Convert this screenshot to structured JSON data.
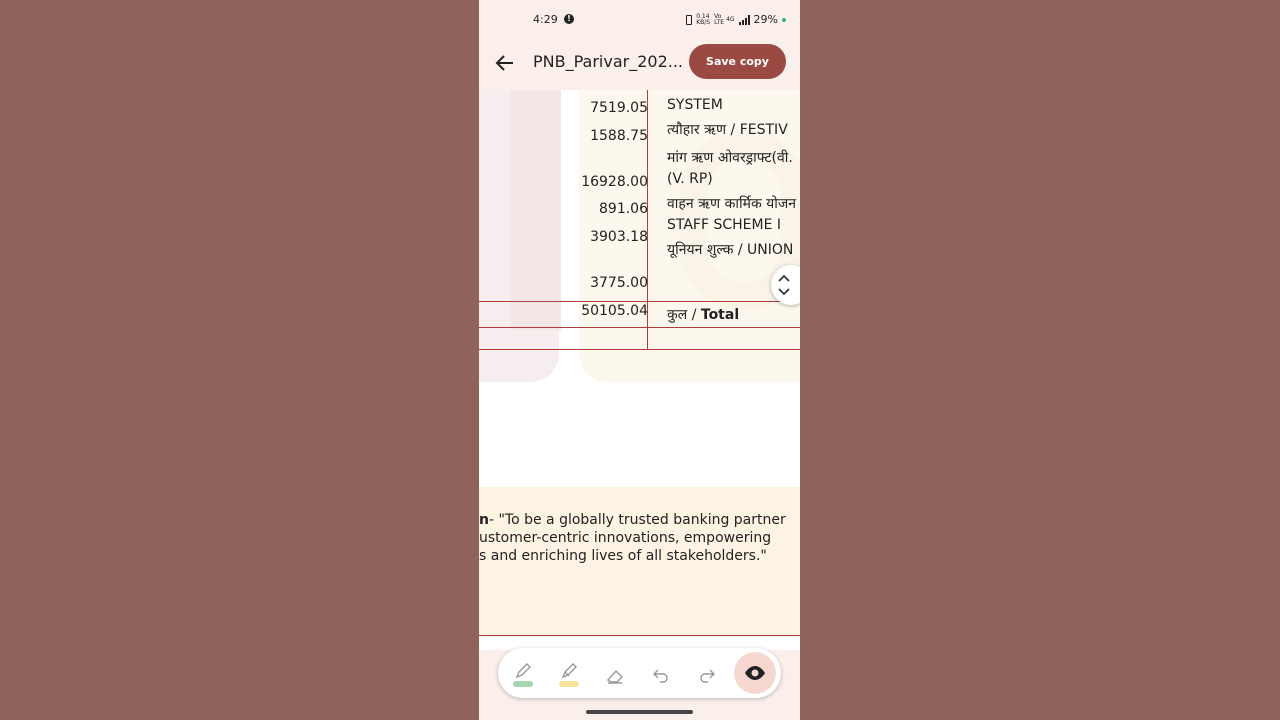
{
  "status_bar": {
    "time": "4:29",
    "alert_glyph": "!",
    "net_speed": "0.14",
    "net_unit": "KB/S",
    "vo_lte": "Vo LTE",
    "signal": "4G",
    "battery": "29%"
  },
  "app_bar": {
    "back_icon": "arrow-left-icon",
    "file_title": "PNB_Parivar_202...",
    "save_label": "Save copy"
  },
  "table": {
    "rows": [
      {
        "amount": "7519.05",
        "desc": "SYSTEM"
      },
      {
        "amount": "1588.75",
        "desc": "त्यौहार ऋण / FESTIV"
      },
      {
        "amount": "",
        "desc": "मांग ऋण ओवरड्राफ्ट(वी."
      },
      {
        "amount": "16928.00",
        "desc": "(V. RP)"
      },
      {
        "amount": "891.06",
        "desc": "वाहन ऋण कार्मिक योजन"
      },
      {
        "amount": "3903.18",
        "desc": "STAFF SCHEME I"
      },
      {
        "amount": "",
        "desc": "यूनियन शुल्क / UNION"
      },
      {
        "amount": "3775.00",
        "desc": ""
      }
    ],
    "total_amount": "50105.04",
    "total_label_hi": "कुल / ",
    "total_label_en": "Total"
  },
  "vision": {
    "line1_bold": "n",
    "line1": "- \"To be a globally trusted banking partner",
    "line2": "ustomer-centric innovations, empowering",
    "line3": "s and enriching lives of all stakeholders.\""
  },
  "toolbar": {
    "tools": [
      "pen-icon",
      "highlighter-icon",
      "eraser-icon",
      "undo-icon",
      "redo-icon",
      "eye-icon"
    ],
    "pen_color": "#a8d5b0",
    "highlighter_color": "#f7e39a",
    "active_color": "#f6d8d0"
  },
  "colors": {
    "background": "#8f625b",
    "accent": "#9a4a42",
    "rule": "#b23a3a"
  }
}
